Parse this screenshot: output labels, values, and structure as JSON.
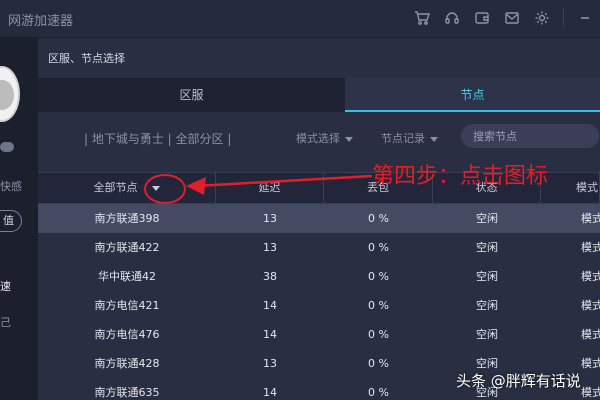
{
  "app": {
    "title": "网游加速器"
  },
  "titlebar": {
    "icons": [
      "cart-icon",
      "headset-icon",
      "wallet-icon",
      "mail-icon",
      "gear-icon",
      "minimize-icon"
    ]
  },
  "sidebar": {
    "text1": "快感",
    "button": "值",
    "text2": "速",
    "text3": "己"
  },
  "panel": {
    "title": "区服、节点选择",
    "tabs": [
      {
        "label": "区服",
        "active": false
      },
      {
        "label": "节点",
        "active": true
      }
    ],
    "breadcrumb": "| 地下城与勇士 | 全部分区 |",
    "mode_select": "模式选择",
    "record_select": "节点记录",
    "search_placeholder": "搜索节点"
  },
  "table": {
    "headers": [
      "全部节点",
      "延迟",
      "丢包",
      "状态",
      "模式"
    ],
    "rows": [
      [
        "南方联通398",
        "13",
        "0 %",
        "空闲",
        "模式"
      ],
      [
        "南方联通422",
        "13",
        "0 %",
        "空闲",
        "模式"
      ],
      [
        "华中联通42",
        "38",
        "0 %",
        "空闲",
        "模式"
      ],
      [
        "南方电信421",
        "14",
        "0 %",
        "空闲",
        "模式"
      ],
      [
        "南方电信476",
        "14",
        "0 %",
        "空闲",
        "模式"
      ],
      [
        "南方联通428",
        "13",
        "0 %",
        "空闲",
        "模式"
      ],
      [
        "南方联通635",
        "14",
        "0 %",
        "空闲",
        "模式"
      ]
    ],
    "selected_row": 0
  },
  "annotation": {
    "text": "第四步：点击图标",
    "color": "#e01f2a"
  },
  "watermark": "头条 @胖辉有话说",
  "colors": {
    "accent": "#2cc4ea",
    "background": "#262a3d",
    "annotation": "#e01f2a"
  }
}
